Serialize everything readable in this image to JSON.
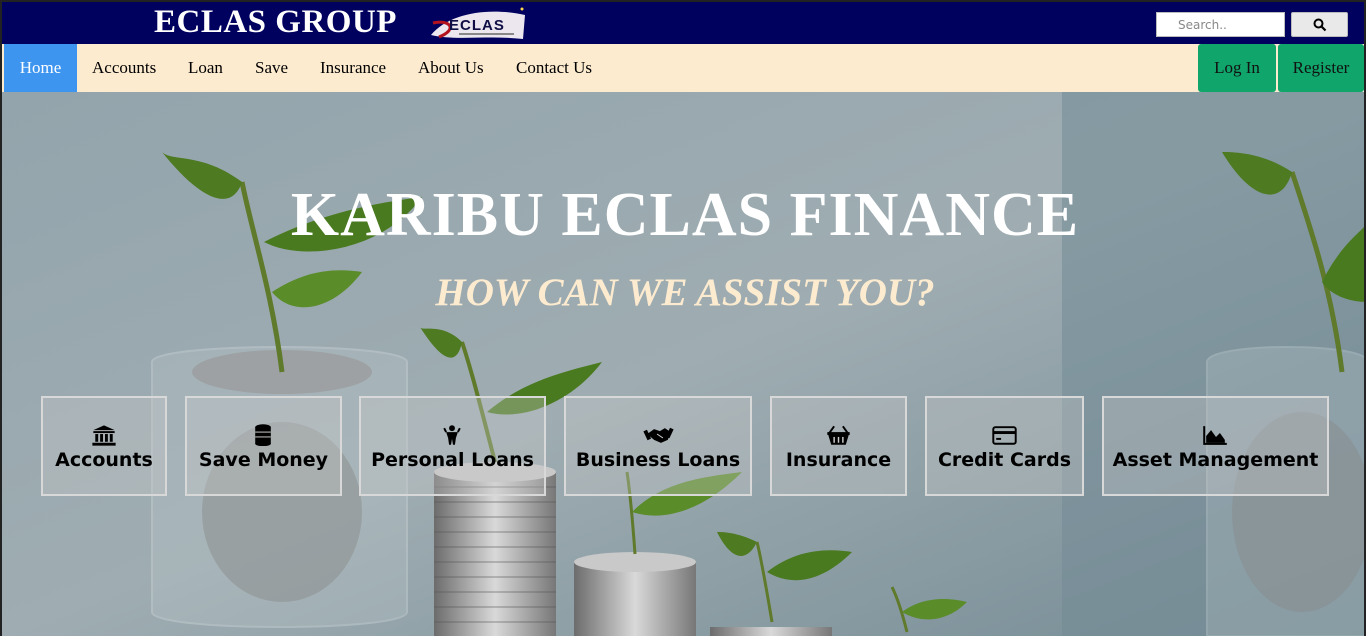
{
  "header": {
    "brand": "ECLAS GROUP",
    "logo_text": "ECLAS",
    "search": {
      "placeholder": "Search.."
    },
    "search_icon": "magnifier-icon"
  },
  "nav": {
    "items": [
      {
        "label": "Home",
        "active": true
      },
      {
        "label": "Accounts"
      },
      {
        "label": "Loan"
      },
      {
        "label": "Save"
      },
      {
        "label": "Insurance"
      },
      {
        "label": "About Us"
      },
      {
        "label": "Contact Us"
      }
    ],
    "login": "Log In",
    "register": "Register"
  },
  "hero": {
    "title": "KARIBU ECLAS FINANCE",
    "subtitle": "HOW CAN WE ASSIST YOU?"
  },
  "services": [
    {
      "label": "Accounts",
      "icon": "bank-icon"
    },
    {
      "label": "Save Money",
      "icon": "coins-icon"
    },
    {
      "label": "Personal Loans",
      "icon": "person-icon"
    },
    {
      "label": "Business Loans",
      "icon": "handshake-icon"
    },
    {
      "label": "Insurance",
      "icon": "basket-icon"
    },
    {
      "label": "Credit Cards",
      "icon": "credit-card-icon"
    },
    {
      "label": "Asset Management",
      "icon": "area-chart-icon"
    }
  ],
  "colors": {
    "topbar": "#00005f",
    "navbar": "#fdebd0",
    "active_nav": "#3d95ef",
    "auth_button": "#10a56b",
    "subtitle": "#fdebd0"
  }
}
